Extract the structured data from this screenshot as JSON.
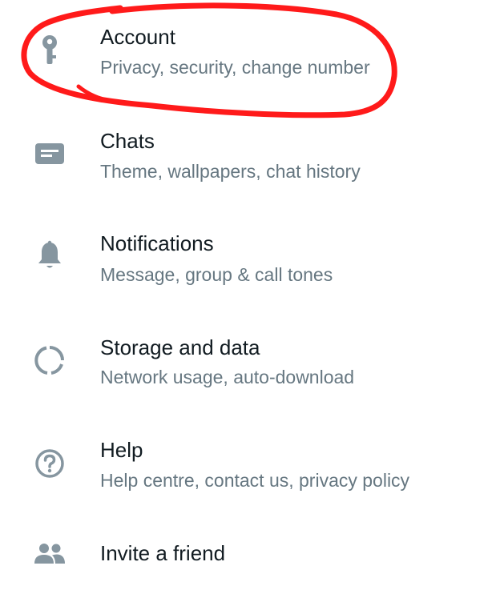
{
  "settings": {
    "items": [
      {
        "icon": "key-icon",
        "title": "Account",
        "subtitle": "Privacy, security, change number"
      },
      {
        "icon": "chat-icon",
        "title": "Chats",
        "subtitle": "Theme, wallpapers, chat history"
      },
      {
        "icon": "bell-icon",
        "title": "Notifications",
        "subtitle": "Message, group & call tones"
      },
      {
        "icon": "data-usage-icon",
        "title": "Storage and data",
        "subtitle": "Network usage, auto-download"
      },
      {
        "icon": "help-icon",
        "title": "Help",
        "subtitle": "Help centre, contact us, privacy policy"
      },
      {
        "icon": "people-icon",
        "title": "Invite a friend"
      }
    ]
  },
  "colors": {
    "icon": "#8696a0",
    "title": "#111b21",
    "subtitle": "#667781",
    "annotation": "#ff1a1a"
  }
}
